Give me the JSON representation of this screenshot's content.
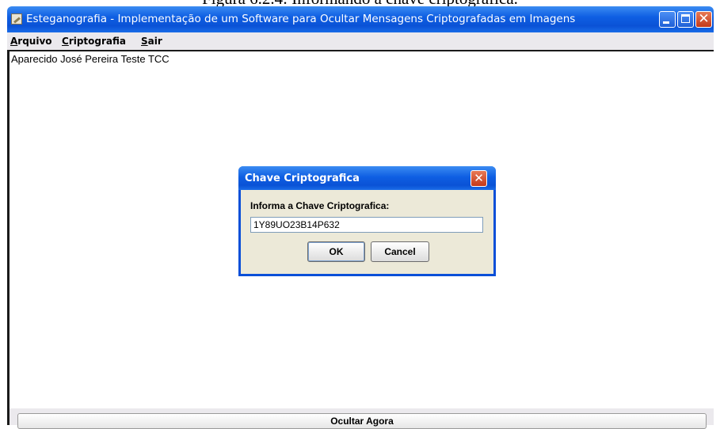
{
  "caption": "Figura 6.2.4: Informando a chave criptografica.",
  "window": {
    "title": "Esteganografia - Implementação de um Software para Ocultar Mensagens Criptografadas em Imagens",
    "icon": "app-icon",
    "controls": {
      "minimize": "minimize-icon",
      "maximize": "maximize-icon",
      "close": "✕"
    }
  },
  "menu": {
    "items": [
      {
        "underline": "A",
        "rest": "rquivo"
      },
      {
        "underline": "C",
        "rest": "riptografia"
      },
      {
        "underline": "S",
        "rest": "air"
      }
    ]
  },
  "content": {
    "text": "Aparecido José Pereira Teste TCC"
  },
  "bottom": {
    "button_label": "Ocultar Agora"
  },
  "dialog": {
    "title": "Chave Criptografica",
    "close": "✕",
    "label": "Informa  a Chave Criptografica:",
    "input_value": "1Y89UO23B14P632",
    "ok_label": "OK",
    "cancel_label": "Cancel"
  }
}
